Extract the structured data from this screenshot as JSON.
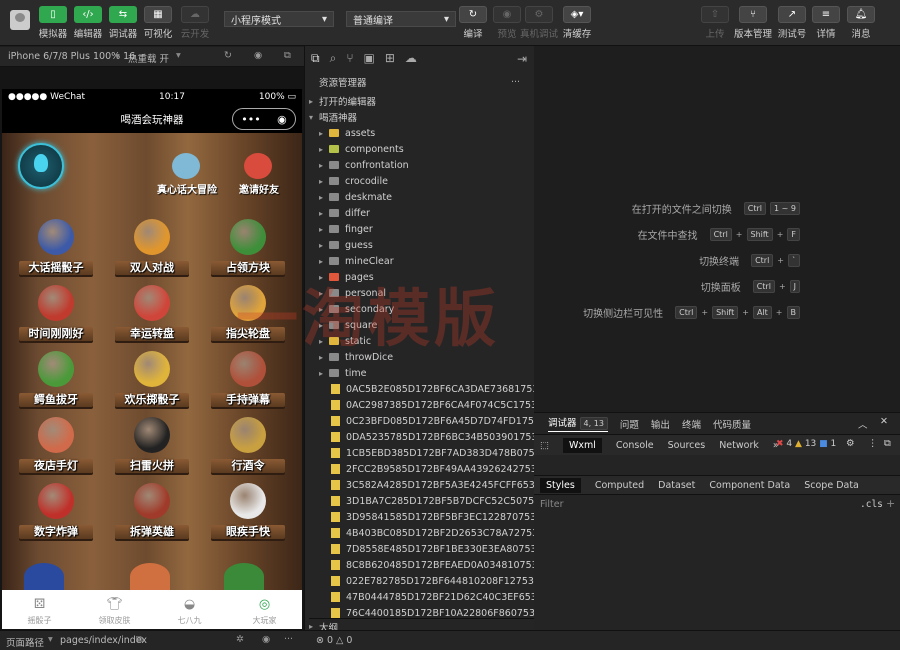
{
  "toolbar": {
    "simulator": "模拟器",
    "editor": "编辑器",
    "debugger": "调试器",
    "visual": "可视化",
    "cloud_dev": "云开发",
    "mode": "小程序模式",
    "compile_mode": "普通编译",
    "compile": "编译",
    "preview": "预览",
    "device_debug": "真机调试",
    "clear_cache": "清缓存",
    "upload": "上传",
    "version_mgmt": "版本管理",
    "test_account": "测试号",
    "details": "详情",
    "messages": "消息"
  },
  "subbar": {
    "device": "iPhone 6/7/8 Plus 100% 16",
    "hot_reload": "热重载 开"
  },
  "phone": {
    "carrier": "●●●●● WeChat",
    "time": "10:17",
    "battery": "100%",
    "title": "喝酒会玩神器",
    "capsule_more": "•••",
    "top_games": [
      {
        "name": "真心话大冒险",
        "color": "#7fb9d6"
      },
      {
        "name": "邀请好友",
        "color": "#d94b3c"
      }
    ],
    "games": [
      {
        "name": "大话摇骰子",
        "color": "#3c5aa8"
      },
      {
        "name": "双人对战",
        "color": "#e0962c"
      },
      {
        "name": "占领方块",
        "color": "#3e8f3a"
      },
      {
        "name": "时间刚刚好",
        "color": "#c03a2e"
      },
      {
        "name": "幸运转盘",
        "color": "#d0453a"
      },
      {
        "name": "指尖轮盘",
        "color": "#e0a43a"
      },
      {
        "name": "鳄鱼拔牙",
        "color": "#4a9a3a"
      },
      {
        "name": "欢乐掷骰子",
        "color": "#e0b43a"
      },
      {
        "name": "手持弹幕",
        "color": "#b0503a"
      },
      {
        "name": "夜店手灯",
        "color": "#d06a4a"
      },
      {
        "name": "扫雷火拼",
        "color": "#222222"
      },
      {
        "name": "行酒令",
        "color": "#c9a040"
      },
      {
        "name": "数字炸弹",
        "color": "#c0302a"
      },
      {
        "name": "拆弹英雄",
        "color": "#a03a2a"
      },
      {
        "name": "眼疾手快",
        "color": "#e8e8e8"
      }
    ],
    "tabs": [
      "摇骰子",
      "领取皮肤",
      "七八九",
      "大玩家"
    ]
  },
  "explorer": {
    "title": "资源管理器",
    "open_editors": "打开的编辑器",
    "project": "喝酒神器",
    "folders": [
      {
        "name": "assets",
        "kind": "y"
      },
      {
        "name": "components",
        "kind": "l"
      },
      {
        "name": "confrontation",
        "kind": "g"
      },
      {
        "name": "crocodile",
        "kind": "g"
      },
      {
        "name": "deskmate",
        "kind": "g"
      },
      {
        "name": "differ",
        "kind": "g"
      },
      {
        "name": "finger",
        "kind": "g"
      },
      {
        "name": "guess",
        "kind": "g"
      },
      {
        "name": "mineClear",
        "kind": "g"
      },
      {
        "name": "pages",
        "kind": "r"
      },
      {
        "name": "personal",
        "kind": "g"
      },
      {
        "name": "secondary",
        "kind": "g"
      },
      {
        "name": "square",
        "kind": "g"
      },
      {
        "name": "static",
        "kind": "y"
      },
      {
        "name": "throwDice",
        "kind": "g"
      },
      {
        "name": "time",
        "kind": "g"
      }
    ],
    "files": [
      "0AC5B2E085D172BF6CA3DAE736817533.js",
      "0AC2987385D172BF6CA4F074C5C17533.js",
      "0C23BFD085D172BF6A45D7D74FD17533.js",
      "0DA5235785D172BF6BC34B5039017533.js",
      "1CB5EBD385D172BF7AD383D478B07533.js",
      "2FCC2B9585D172BF49AA439262427533.js",
      "3C582A4285D172BF5A3E4245FCFF6533.js",
      "3D1BA7C285D172BF5B7DCFC52C507533.js",
      "3D95841585D172BF5BF3EC1228707533.js",
      "4B403BC085D172BF2D2653C78A727533.js",
      "7D8558E485D172BF1BE330E3EA807533.js",
      "8C8B620485D172BFEAED0A0348107533.js",
      "022E782785D172BF644810208F127533.js",
      "47B0444785D172BF21D62C40C3EF6533.js",
      "76C4400185D172BF10A22806F8607533.js"
    ],
    "outline": "大纲"
  },
  "shortcuts": [
    {
      "label": "在打开的文件之间切换",
      "keys": [
        "Ctrl",
        "1 ~ 9"
      ]
    },
    {
      "label": "在文件中查找",
      "keys": [
        "Ctrl",
        "+",
        "Shift",
        "+",
        "F"
      ]
    },
    {
      "label": "切换终端",
      "keys": [
        "Ctrl",
        "+",
        "`"
      ]
    },
    {
      "label": "切换面板",
      "keys": [
        "Ctrl",
        "+",
        "J"
      ]
    },
    {
      "label": "切换侧边栏可见性",
      "keys": [
        "Ctrl",
        "+",
        "Shift",
        "+",
        "Alt",
        "+",
        "B"
      ]
    }
  ],
  "watermark": "一淘模版",
  "devtools": {
    "tabs": [
      "调试器",
      "问题",
      "输出",
      "终端",
      "代码质量"
    ],
    "debugger_badge": "4, 13",
    "panels": [
      "Wxml",
      "Console",
      "Sources",
      "Network",
      "»"
    ],
    "errors": "4",
    "warnings": "13",
    "infos": "1",
    "style_tabs": [
      "Styles",
      "Computed",
      "Dataset",
      "Component Data",
      "Scope Data"
    ],
    "filter_placeholder": "Filter",
    "cls": ".cls",
    "plus": "+"
  },
  "bottombar": {
    "path_label": "页面路径",
    "path": "pages/index/index",
    "errors": "0",
    "warnings": "0"
  }
}
